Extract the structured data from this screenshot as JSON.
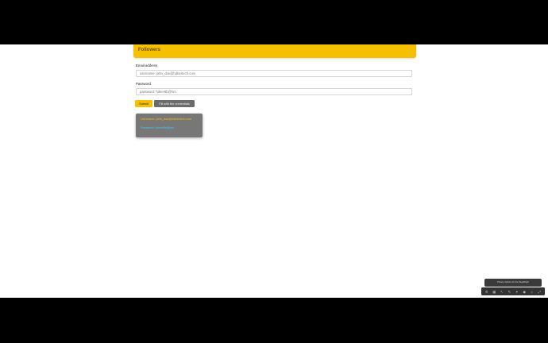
{
  "header": {
    "title": "Followers",
    "accent_color": "#f5c000"
  },
  "form": {
    "email_label": "Email address",
    "email_placeholder": "username: john_doe@hdbertech.com",
    "password_label": "Password",
    "password_placeholder": "password: hdeer8b@hm",
    "submit_label": "Submit",
    "fill_label": "Fill with the credentials"
  },
  "credentials": {
    "username": "Username: john_doe@hdbertech.com",
    "password": "Password: hdeer8b@hm"
  },
  "bottom_widget": {
    "text": "Privacy Options for the PageBright"
  },
  "toolbar": {
    "icons": [
      "gear-icon",
      "grid-icon",
      "cursor-icon",
      "pen-icon",
      "pin-icon",
      "camera-icon",
      "settings-icon",
      "expand-icon"
    ]
  }
}
